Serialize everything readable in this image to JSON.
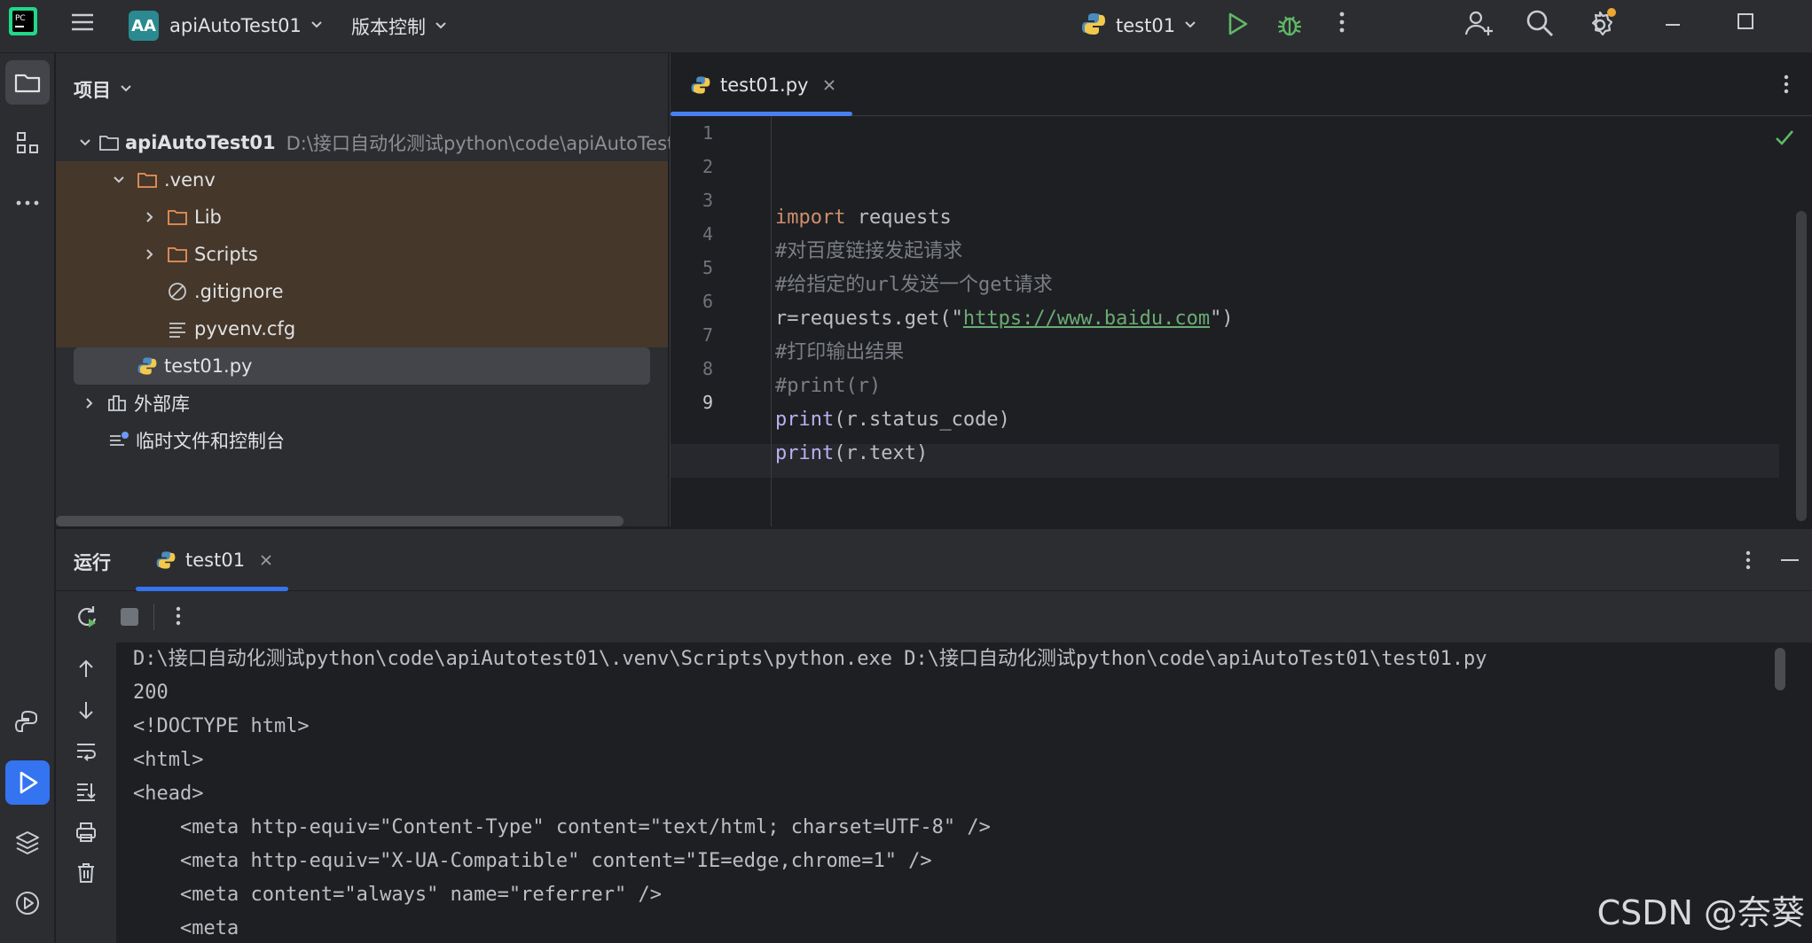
{
  "titlebar": {
    "project_badge": "AA",
    "project_name": "apiAutoTest01",
    "vcs_label": "版本控制",
    "run_config": "test01",
    "accent_run": "#5fb865",
    "badge_color": "#2b8a8f"
  },
  "left_strip": {
    "items": [
      "folder-icon",
      "structure-icon",
      "more-icon",
      "python-console-icon",
      "run-icon",
      "layers-icon",
      "services-icon",
      "terminal-icon"
    ]
  },
  "project_panel": {
    "title": "项目",
    "tree": [
      {
        "name": "apiAutoTest01",
        "path": "D:\\接口自动化测试python\\code\\apiAutoTest"
      },
      {
        "name": ".venv"
      },
      {
        "name": "Lib"
      },
      {
        "name": "Scripts"
      },
      {
        "name": ".gitignore"
      },
      {
        "name": "pyvenv.cfg"
      },
      {
        "name": "test01.py"
      },
      {
        "name": "外部库"
      },
      {
        "name": "临时文件和控制台"
      }
    ]
  },
  "editor": {
    "tab_label": "test01.py",
    "line_numbers": [
      "1",
      "2",
      "3",
      "4",
      "5",
      "6",
      "7",
      "8",
      "9"
    ],
    "code": {
      "l2_kw": "import",
      "l2_rest": " requests",
      "l3": "#对百度链接发起请求",
      "l4": "#给指定的url发送一个get请求",
      "l5_a": "r=requests.get(\"",
      "l5_url": "https://www.baidu.com",
      "l5_b": "\")",
      "l6": "#打印输出结果",
      "l7": "#print(r)",
      "l8_fn": "print",
      "l8_rest": "(r.status_code)",
      "l9_fn": "print",
      "l9_rest": "(r.text)"
    }
  },
  "run_panel": {
    "title": "运行",
    "tab_label": "test01",
    "console": [
      "D:\\接口自动化测试python\\code\\apiAutotest01\\.venv\\Scripts\\python.exe D:\\接口自动化测试python\\code\\apiAutoTest01\\test01.py",
      "200",
      "<!DOCTYPE html>",
      "<html>",
      "<head>",
      "    <meta http-equiv=\"Content-Type\" content=\"text/html; charset=UTF-8\" />",
      "    <meta http-equiv=\"X-UA-Compatible\" content=\"IE=edge,chrome=1\" />",
      "    <meta content=\"always\" name=\"referrer\" />",
      "    <meta"
    ]
  },
  "watermark": "CSDN @奈葵"
}
